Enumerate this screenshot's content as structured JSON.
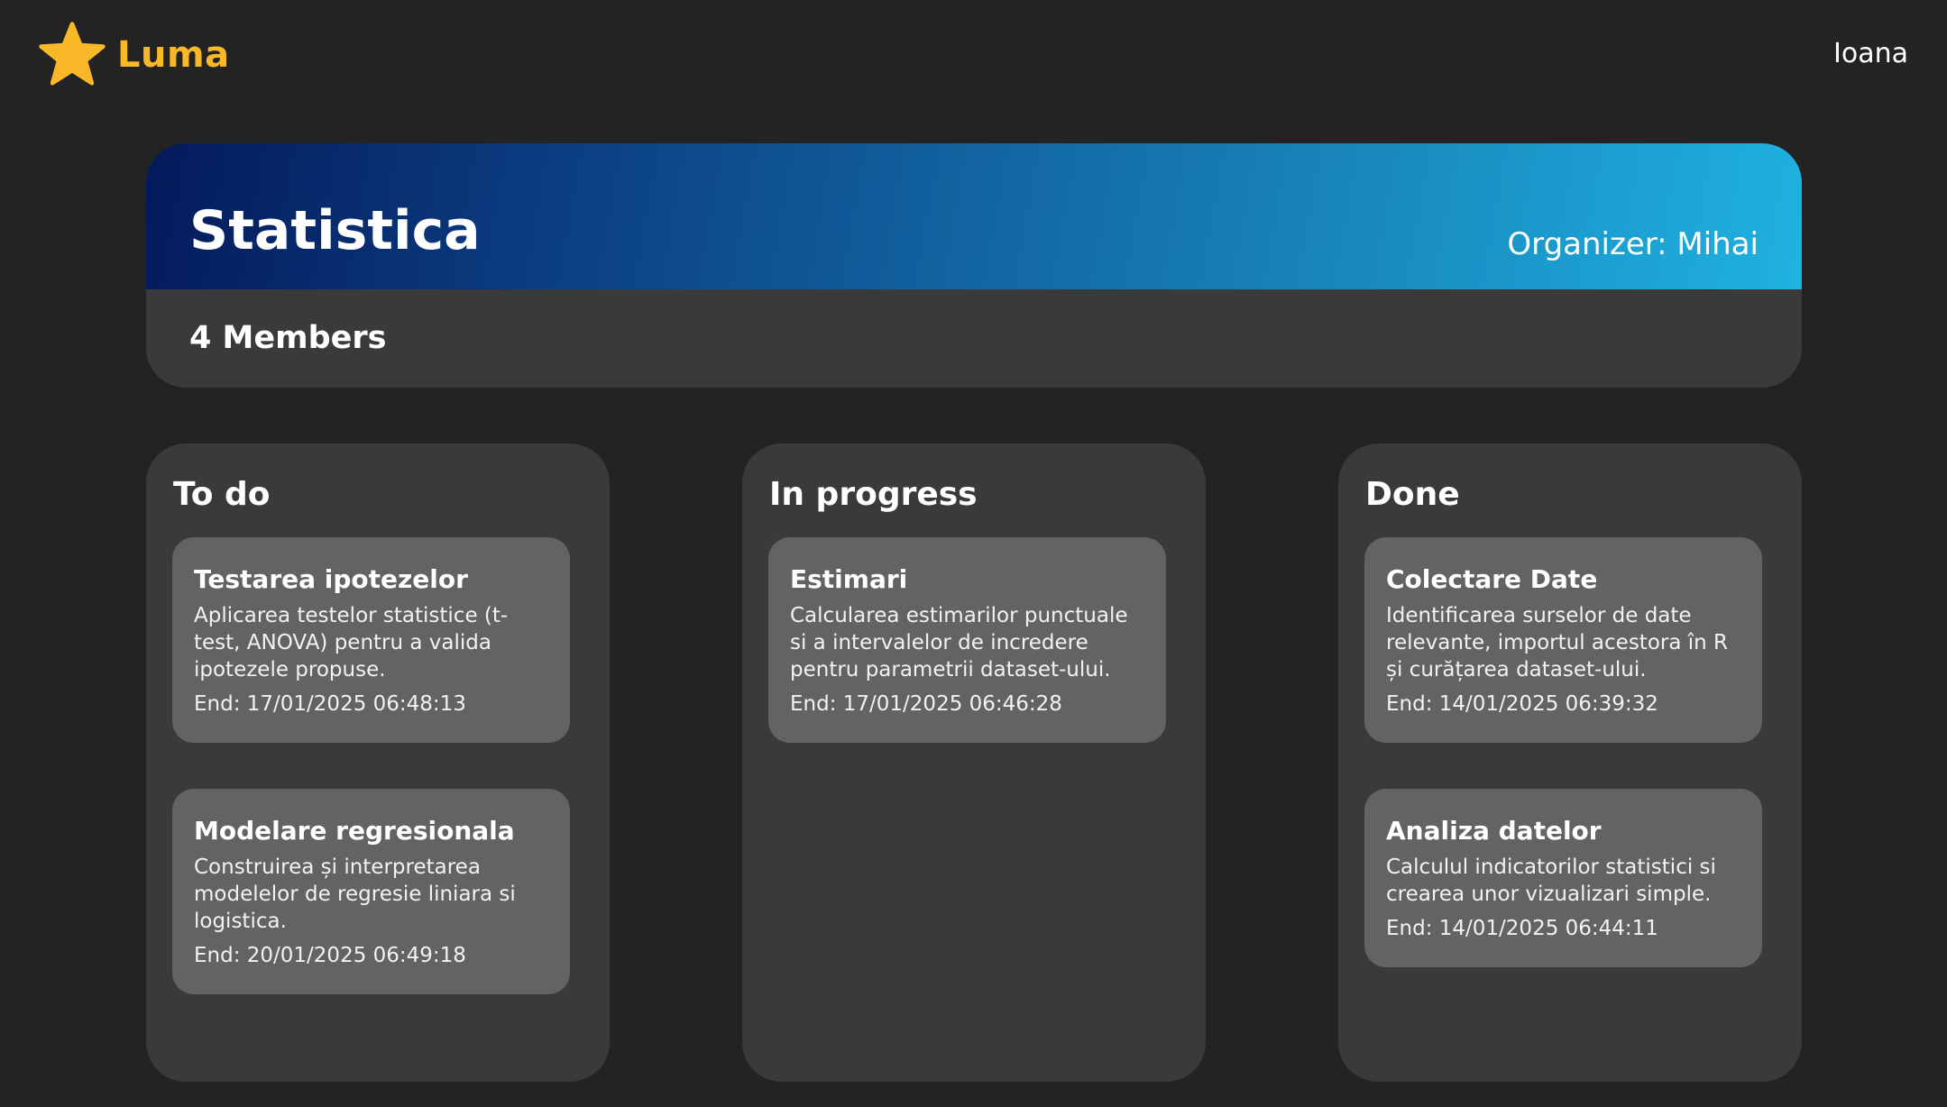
{
  "app": {
    "logo_text": "Luma",
    "logo_icon": "star-icon",
    "brand_color": "#f8b828"
  },
  "user": {
    "name": "Ioana"
  },
  "project": {
    "title": "Statistica",
    "organizer": "Organizer: Mihai",
    "members": "4 Members"
  },
  "columns": [
    {
      "title": "To do",
      "tasks": [
        {
          "title": "Testarea ipotezelor",
          "description": "Aplicarea testelor statistice (t-test, ANOVA) pentru a valida ipotezele propuse.",
          "end": "End: 17/01/2025 06:48:13"
        },
        {
          "title": "Modelare regresionala",
          "description": "Construirea și interpretarea modelelor de regresie liniara si logistica.",
          "end": "End: 20/01/2025 06:49:18"
        }
      ]
    },
    {
      "title": "In progress",
      "tasks": [
        {
          "title": "Estimari",
          "description": "Calcularea estimarilor punctuale si a intervalelor de incredere pentru parametrii dataset-ului.",
          "end": "End: 17/01/2025 06:46:28"
        }
      ]
    },
    {
      "title": "Done",
      "tasks": [
        {
          "title": "Colectare Date",
          "description": "Identificarea surselor de date relevante, importul acestora în R și curățarea dataset-ului.",
          "end": "End: 14/01/2025 06:39:32"
        },
        {
          "title": "Analiza datelor",
          "description": "Calculul indicatorilor statistici si crearea unor vizualizari simple.",
          "end": "End: 14/01/2025 06:44:11"
        }
      ]
    }
  ]
}
